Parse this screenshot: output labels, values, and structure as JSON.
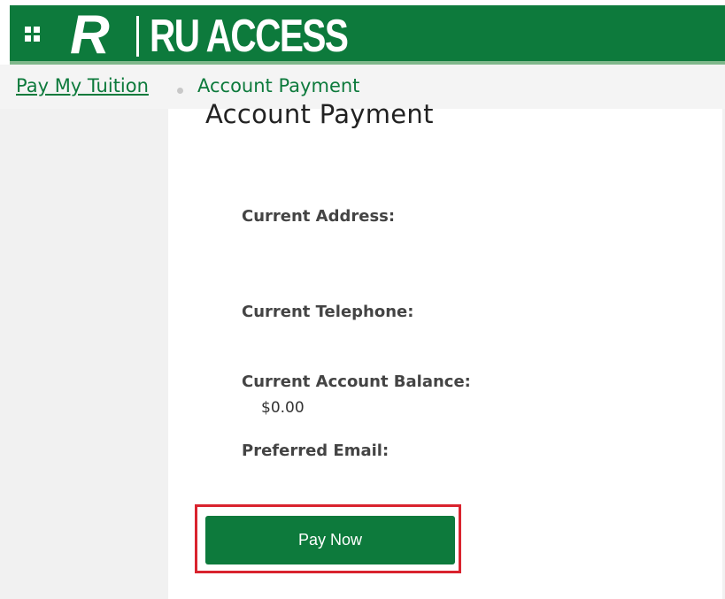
{
  "header": {
    "logo_letter": "R",
    "logo_text": "RU ACCESS",
    "brand_color": "#0d7a3c",
    "apps_icon": "grid-apps-icon"
  },
  "breadcrumb": {
    "parent": "Pay My Tuition",
    "current": "Account Payment"
  },
  "main": {
    "title": "Account Payment",
    "fields": [
      {
        "label": "Current Address:",
        "value": ""
      },
      {
        "label": "Current Telephone:",
        "value": ""
      },
      {
        "label": "Current Account Balance:",
        "value": "$0.00"
      },
      {
        "label": "Preferred Email:",
        "value": ""
      }
    ],
    "pay_button_label": "Pay Now",
    "highlight_color": "#d9232e"
  }
}
